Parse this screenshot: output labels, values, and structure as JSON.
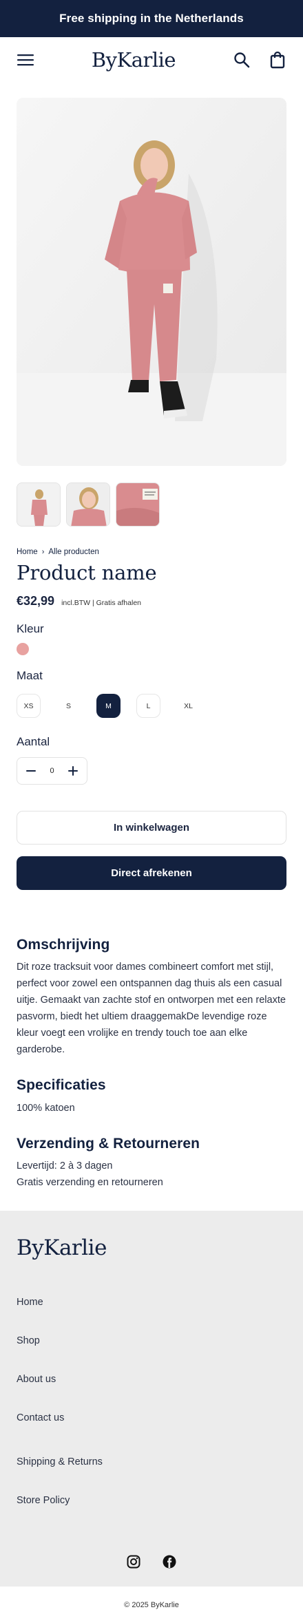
{
  "announcement": {
    "text": "Free shipping in the Netherlands"
  },
  "header": {
    "brand": "ByKarlie",
    "menu_icon": "hamburger-menu-icon",
    "search_icon": "search-icon",
    "cart_icon": "shopping-bag-icon"
  },
  "gallery": {
    "main_image": "pink tracksuit model photo",
    "thumbnails": [
      "full-body front view",
      "close-up upper body",
      "fabric label detail"
    ]
  },
  "breadcrumb": {
    "home": "Home",
    "separator": "›",
    "current": "Alle producten"
  },
  "product": {
    "title": "Product name",
    "price": "€32,99",
    "price_note": "incl.BTW | Gratis afhalen"
  },
  "color": {
    "label": "Kleur",
    "selected_hex": "#e8a2a0"
  },
  "size": {
    "label": "Maat",
    "options": [
      "XS",
      "S",
      "M",
      "L",
      "XL"
    ],
    "selected": "M"
  },
  "quantity": {
    "label": "Aantal",
    "value": "0"
  },
  "actions": {
    "add_to_cart": "In winkelwagen",
    "buy_now": "Direct afrekenen"
  },
  "description": {
    "heading": "Omschrijving",
    "text": "Dit roze tracksuit voor dames combineert comfort met stijl, perfect voor zowel een ontspannen dag thuis als een casual uitje. Gemaakt van zachte stof en ontworpen met een relaxte pasvorm, biedt het ultiem draaggemakDe levendige roze kleur voegt een vrolijke en trendy touch toe aan elke garderobe."
  },
  "specs": {
    "heading": "Specificaties",
    "text": "100% katoen"
  },
  "shipping": {
    "heading": "Verzending & Retourneren",
    "line1": "Levertijd: 2 à 3 dagen",
    "line2": "Gratis verzending en retourneren"
  },
  "footer": {
    "brand": "ByKarlie",
    "links": [
      "Home",
      "Shop",
      "About us",
      "Contact us",
      "Shipping & Returns",
      "Store Policy"
    ],
    "socials": [
      "instagram-icon",
      "facebook-icon"
    ],
    "copyright": "© 2025 ByKarlie"
  },
  "colors": {
    "navy": "#13213f",
    "pink": "#e8a2a0",
    "footer_bg": "#ececec"
  }
}
